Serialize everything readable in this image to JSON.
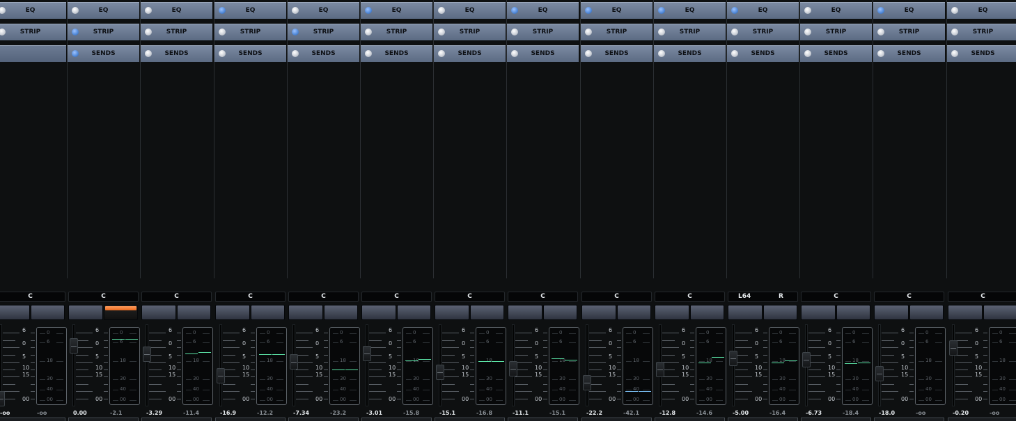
{
  "strips": [
    {
      "eq_label": "EQ",
      "eq_on": false,
      "strip_label": "STRIP",
      "strip_on": false,
      "sends_label": "",
      "sends_on": false,
      "has_sends": false,
      "pan": "C",
      "pan_left": "",
      "pan_right": "",
      "mute_on": false,
      "volume": "-oo",
      "peak": "-oo",
      "fader": 0.02,
      "meter_peaks": []
    },
    {
      "eq_label": "EQ",
      "eq_on": false,
      "strip_label": "STRIP",
      "strip_on": true,
      "sends_label": "SENDS",
      "sends_on": true,
      "has_sends": true,
      "pan": "C",
      "pan_left": "",
      "pan_right": "",
      "mute_on": true,
      "volume": "0.00",
      "peak": "-2.1",
      "fader": 0.78,
      "meter_peaks": [
        0.88,
        0.88
      ]
    },
    {
      "eq_label": "EQ",
      "eq_on": false,
      "strip_label": "STRIP",
      "strip_on": false,
      "sends_label": "SENDS",
      "sends_on": false,
      "has_sends": true,
      "pan": "C",
      "pan_left": "",
      "pan_right": "",
      "mute_on": false,
      "volume": "-3.29",
      "peak": "-11.4",
      "fader": 0.66,
      "meter_peaks": [
        0.68,
        0.7
      ]
    },
    {
      "eq_label": "EQ",
      "eq_on": true,
      "strip_label": "STRIP",
      "strip_on": false,
      "sends_label": "SENDS",
      "sends_on": false,
      "has_sends": true,
      "pan": "C",
      "pan_left": "",
      "pan_right": "",
      "mute_on": false,
      "volume": "-16.9",
      "peak": "-12.2",
      "fader": 0.35,
      "meter_peaks": [
        0.67,
        0.67
      ]
    },
    {
      "eq_label": "EQ",
      "eq_on": false,
      "strip_label": "STRIP",
      "strip_on": true,
      "sends_label": "SENDS",
      "sends_on": false,
      "has_sends": true,
      "pan": "C",
      "pan_left": "",
      "pan_right": "",
      "mute_on": false,
      "volume": "-7.34",
      "peak": "-23.2",
      "fader": 0.55,
      "meter_peaks": [
        0.46,
        0.46
      ]
    },
    {
      "eq_label": "EQ",
      "eq_on": true,
      "strip_label": "STRIP",
      "strip_on": false,
      "sends_label": "SENDS",
      "sends_on": false,
      "has_sends": true,
      "pan": "C",
      "pan_left": "",
      "pan_right": "",
      "mute_on": false,
      "volume": "-3.01",
      "peak": "-15.8",
      "fader": 0.67,
      "meter_peaks": [
        0.58,
        0.6
      ]
    },
    {
      "eq_label": "EQ",
      "eq_on": false,
      "strip_label": "STRIP",
      "strip_on": false,
      "sends_label": "SENDS",
      "sends_on": false,
      "has_sends": true,
      "pan": "C",
      "pan_left": "",
      "pan_right": "",
      "mute_on": false,
      "volume": "-15.1",
      "peak": "-16.8",
      "fader": 0.4,
      "meter_peaks": [
        0.57,
        0.57
      ]
    },
    {
      "eq_label": "EQ",
      "eq_on": true,
      "strip_label": "STRIP",
      "strip_on": false,
      "sends_label": "SENDS",
      "sends_on": false,
      "has_sends": true,
      "pan": "C",
      "pan_left": "",
      "pan_right": "",
      "mute_on": false,
      "volume": "-11.1",
      "peak": "-15.1",
      "fader": 0.45,
      "meter_peaks": [
        0.61,
        0.59
      ]
    },
    {
      "eq_label": "EQ",
      "eq_on": true,
      "strip_label": "STRIP",
      "strip_on": false,
      "sends_label": "SENDS",
      "sends_on": false,
      "has_sends": true,
      "pan": "C",
      "pan_left": "",
      "pan_right": "",
      "mute_on": false,
      "volume": "-22.2",
      "peak": "-42.1",
      "fader": 0.25,
      "meter_peaks": [
        0.16,
        0.16
      ]
    },
    {
      "eq_label": "EQ",
      "eq_on": true,
      "strip_label": "STRIP",
      "strip_on": false,
      "sends_label": "SENDS",
      "sends_on": false,
      "has_sends": true,
      "pan": "C",
      "pan_left": "",
      "pan_right": "",
      "mute_on": false,
      "volume": "-12.8",
      "peak": "-14.6",
      "fader": 0.44,
      "meter_peaks": [
        0.55,
        0.63
      ]
    },
    {
      "eq_label": "EQ",
      "eq_on": true,
      "strip_label": "STRIP",
      "strip_on": false,
      "sends_label": "SENDS",
      "sends_on": false,
      "has_sends": true,
      "pan": "",
      "pan_left": "L64",
      "pan_right": "R",
      "mute_on": false,
      "volume": "-5.00",
      "peak": "-16.4",
      "fader": 0.6,
      "meter_peaks": [
        0.55,
        0.58
      ]
    },
    {
      "eq_label": "EQ",
      "eq_on": false,
      "strip_label": "STRIP",
      "strip_on": false,
      "sends_label": "SENDS",
      "sends_on": false,
      "has_sends": true,
      "pan": "C",
      "pan_left": "",
      "pan_right": "",
      "mute_on": false,
      "volume": "-6.73",
      "peak": "-18.4",
      "fader": 0.58,
      "meter_peaks": [
        0.54,
        0.55
      ]
    },
    {
      "eq_label": "EQ",
      "eq_on": true,
      "strip_label": "STRIP",
      "strip_on": false,
      "sends_label": "SENDS",
      "sends_on": false,
      "has_sends": true,
      "pan": "C",
      "pan_left": "",
      "pan_right": "",
      "mute_on": false,
      "volume": "-18.0",
      "peak": "-oo",
      "fader": 0.38,
      "meter_peaks": []
    },
    {
      "eq_label": "EQ",
      "eq_on": false,
      "strip_label": "STRIP",
      "strip_on": false,
      "sends_label": "SENDS",
      "sends_on": false,
      "has_sends": true,
      "pan": "C",
      "pan_left": "",
      "pan_right": "",
      "mute_on": false,
      "volume": "-0.20",
      "peak": "-oo",
      "fader": 0.75,
      "meter_peaks": []
    }
  ],
  "fader_scale": [
    "6",
    "0",
    "5",
    "10",
    "15",
    "00"
  ],
  "meter_scale": [
    "0",
    "6",
    "18",
    "30",
    "40",
    "00"
  ],
  "colors": {
    "led_on": "#4f87d6",
    "led_off": "#d8dce2",
    "meter_peak": "#5be3a6",
    "meter_low": "#7fc7ff",
    "mute_on": "#e9681f"
  }
}
